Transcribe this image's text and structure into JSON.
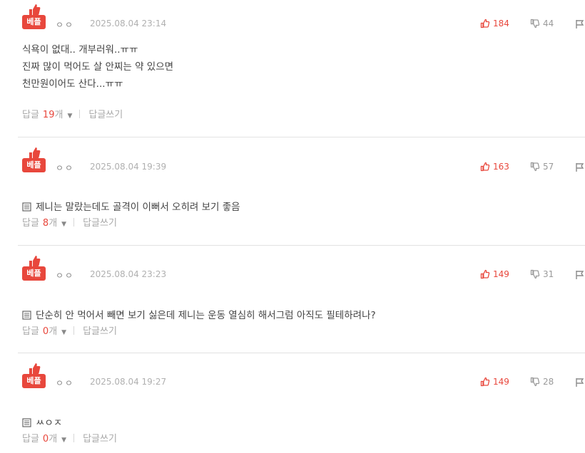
{
  "badge_label": "베플",
  "reply_label": "답글",
  "reply_unit": "개",
  "write_reply_label": "답글쓰기",
  "accent_color": "#e8473c",
  "comments": [
    {
      "nickname": "ㅇㅇ",
      "date": "2025.08.04 23:14",
      "likes": "184",
      "dislikes": "44",
      "text": "식욕이 없대.. 개부러워..ㅠㅠ\n진짜 많이 먹어도 살 안찌는 약 있으면\n천만원이어도 산다...ㅠㅠ",
      "has_image_icon": false,
      "reply_count": "19"
    },
    {
      "nickname": "ㅇㅇ",
      "date": "2025.08.04 19:39",
      "likes": "163",
      "dislikes": "57",
      "text": "제니는 말랐는데도 골격이 이뻐서 오히려 보기 좋음",
      "has_image_icon": true,
      "reply_count": "8"
    },
    {
      "nickname": "ㅇㅇ",
      "date": "2025.08.04 23:23",
      "likes": "149",
      "dislikes": "31",
      "text": "단순히 안 먹어서 빼면 보기 싫은데 제니는 운동 열심히 해서그럼 아직도 필테하려나?",
      "has_image_icon": true,
      "reply_count": "0"
    },
    {
      "nickname": "ㅇㅇ",
      "date": "2025.08.04 19:27",
      "likes": "149",
      "dislikes": "28",
      "text": "ㅆㅇㅈ",
      "has_image_icon": true,
      "reply_count": "0"
    }
  ]
}
